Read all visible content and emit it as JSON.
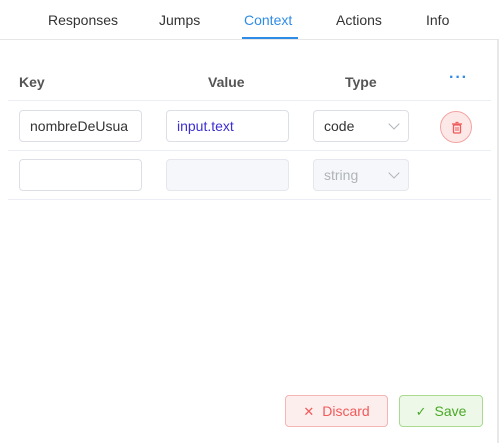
{
  "tabs": [
    {
      "label": "Responses",
      "active": false
    },
    {
      "label": "Jumps",
      "active": false
    },
    {
      "label": "Context",
      "active": true
    },
    {
      "label": "Actions",
      "active": false
    },
    {
      "label": "Info",
      "active": false
    }
  ],
  "table": {
    "headers": {
      "key": "Key",
      "value": "Value",
      "type": "Type"
    },
    "more_icon": "more-horizontal-icon",
    "rows": [
      {
        "key": "nombreDeUsua",
        "value": "input.text",
        "type": "code",
        "delete_icon": "trash-icon"
      },
      {
        "key": "",
        "value": "",
        "type": "string"
      }
    ]
  },
  "footer": {
    "discard_label": "Discard",
    "discard_icon": "close-icon",
    "save_label": "Save",
    "save_icon": "check-icon"
  },
  "colors": {
    "accent": "#2f8ce6",
    "danger": "#f05a5a",
    "success": "#4aa827",
    "code_text": "#3d2fd1"
  }
}
